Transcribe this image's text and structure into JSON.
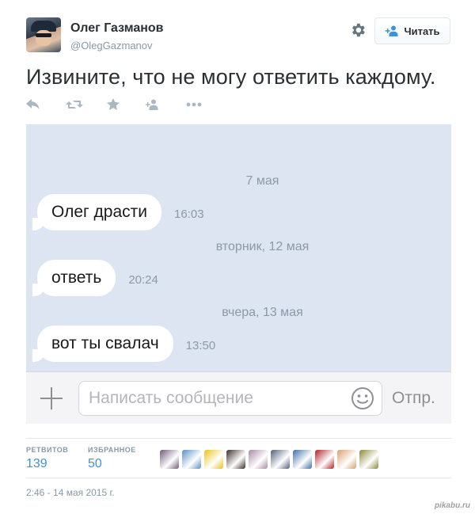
{
  "author": {
    "name": "Олег Газманов",
    "handle": "@OlegGazmanov"
  },
  "header": {
    "follow_label": "Читать"
  },
  "tweet": {
    "text": "Извините, что не могу ответить каждому.",
    "actions": [
      "reply-icon",
      "retweet-icon",
      "favorite-icon",
      "follow-icon",
      "more-icon"
    ]
  },
  "chat": {
    "dates": [
      "7 мая",
      "вторник, 12 мая",
      "вчера, 13 мая"
    ],
    "messages": [
      {
        "text": "Олег драсти",
        "time": "16:03"
      },
      {
        "text": "ответь",
        "time": "20:24"
      },
      {
        "text": "вот ты свалач",
        "time": "13:50"
      }
    ],
    "input_placeholder": "Написать сообщение",
    "send_label": "Отпр."
  },
  "stats": {
    "retweets_label": "РЕТВИТОВ",
    "retweets_value": "139",
    "favorites_label": "ИЗБРАННОЕ",
    "favorites_value": "50",
    "favoriter_colors": [
      "#6e5a7a",
      "#5b8fc4",
      "#e8c31a",
      "#3a2e28",
      "#a88aa6",
      "#50607a",
      "#3f6fa8",
      "#b02228",
      "#d8a070",
      "#8a8a3a"
    ]
  },
  "timestamp": "2:46 - 14 мая 2015 г.",
  "watermark": "pikabu.ru"
}
